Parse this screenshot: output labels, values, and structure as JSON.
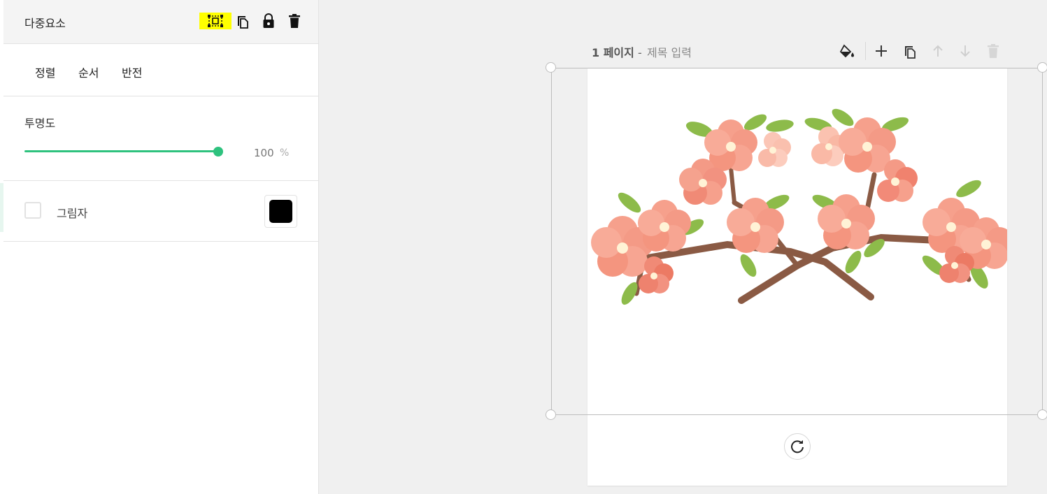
{
  "panel": {
    "title": "다중요소",
    "header_icons": [
      "ungroup-icon",
      "copy-icon",
      "lock-icon",
      "trash-icon"
    ]
  },
  "tabs": [
    {
      "label": "정렬"
    },
    {
      "label": "순서"
    },
    {
      "label": "반전"
    }
  ],
  "opacity": {
    "label": "투명도",
    "value": "100",
    "unit": "%",
    "level": 1.0
  },
  "shadow": {
    "label": "그림자",
    "checked": false,
    "color": "#000000"
  },
  "page_toolbar": {
    "page_label": "1 페이지",
    "separator": " - ",
    "title_placeholder": "제목 입력",
    "icons": [
      "paint-bucket-icon",
      "plus-icon",
      "copy-icon",
      "arrow-up-icon",
      "arrow-down-icon",
      "trash-icon"
    ]
  },
  "colors": {
    "accent": "#2ec27e",
    "selection_highlight": "#ffff00"
  }
}
